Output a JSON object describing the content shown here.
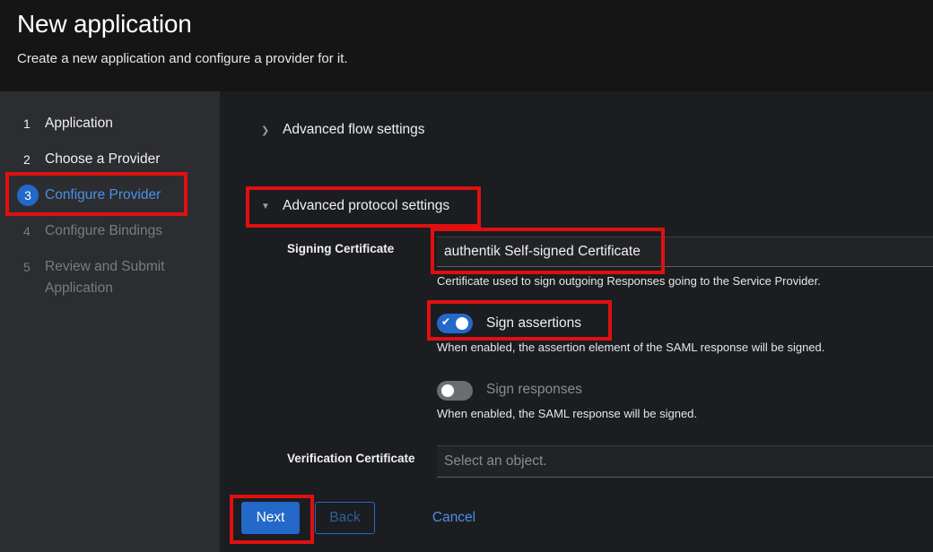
{
  "header": {
    "title": "New application",
    "subtitle": "Create a new application and configure a provider for it."
  },
  "steps": [
    {
      "num": "1",
      "label": "Application",
      "state": "done"
    },
    {
      "num": "2",
      "label": "Choose a Provider",
      "state": "done"
    },
    {
      "num": "3",
      "label": "Configure Provider",
      "state": "current"
    },
    {
      "num": "4",
      "label": "Configure Bindings",
      "state": "disabled"
    },
    {
      "num": "5",
      "label": "Review and Submit Application",
      "state": "disabled"
    }
  ],
  "sections": {
    "flow": {
      "label": "Advanced flow settings",
      "expanded": false
    },
    "protocol": {
      "label": "Advanced protocol settings",
      "expanded": true
    }
  },
  "signing": {
    "label": "Signing Certificate",
    "value": "authentik Self-signed Certificate",
    "help": "Certificate used to sign outgoing Responses going to the Service Provider."
  },
  "sign_assertions": {
    "label": "Sign assertions",
    "enabled": true,
    "help": "When enabled, the assertion element of the SAML response will be signed."
  },
  "sign_responses": {
    "label": "Sign responses",
    "enabled": false,
    "help": "When enabled, the SAML response will be signed."
  },
  "verification": {
    "label": "Verification Certificate",
    "placeholder": "Select an object."
  },
  "footer": {
    "next": "Next",
    "back": "Back",
    "cancel": "Cancel"
  },
  "colors": {
    "accent": "#2468c9",
    "highlight": "#e01010"
  }
}
